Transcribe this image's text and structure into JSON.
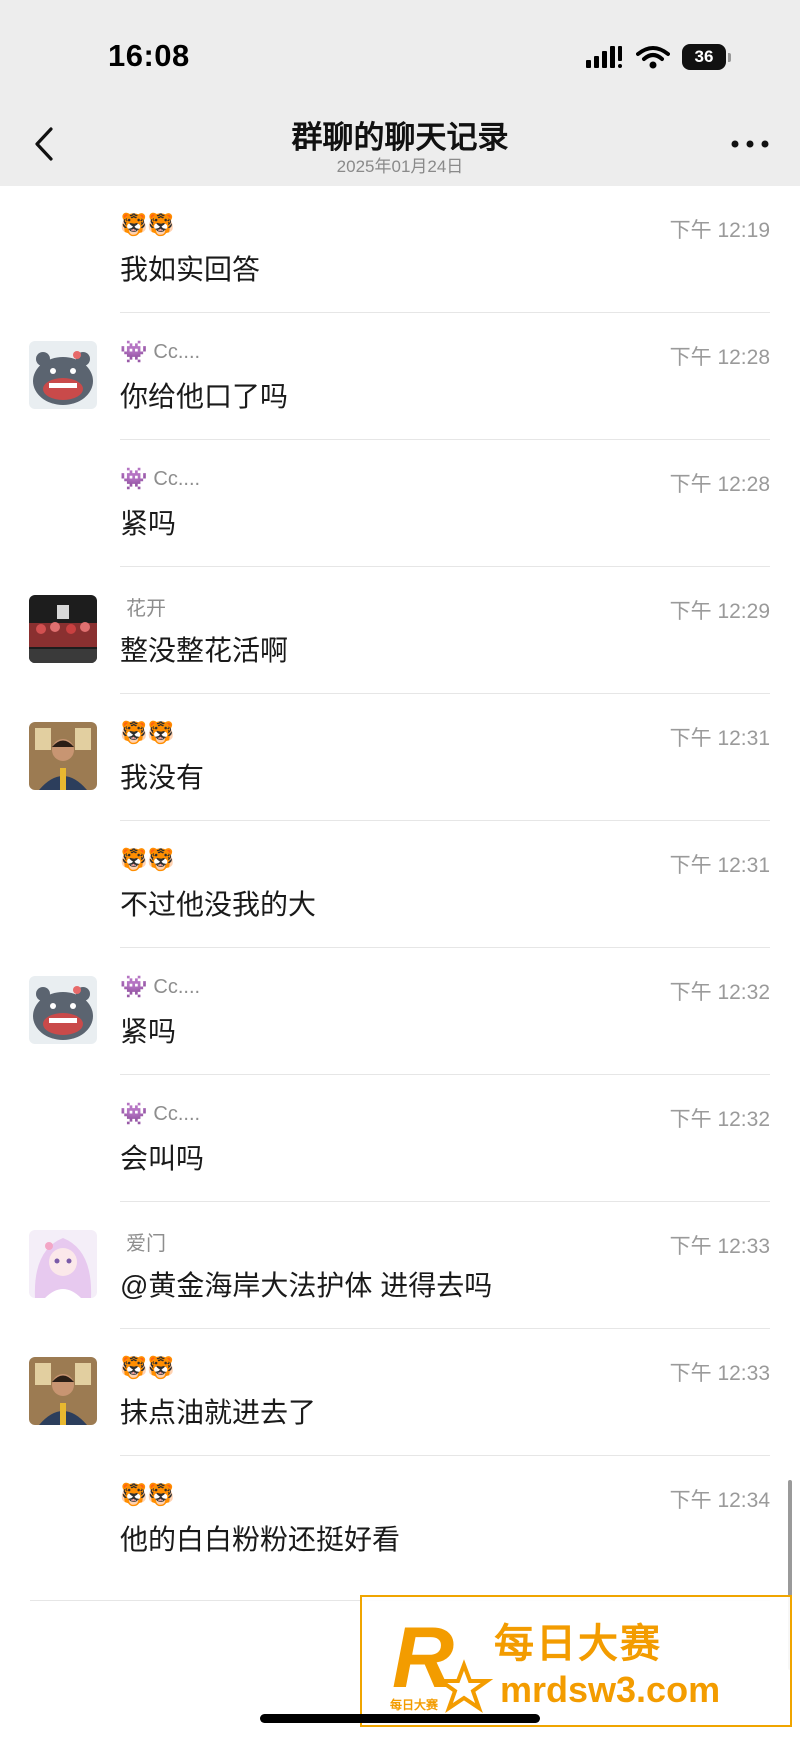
{
  "status_bar": {
    "time": "16:08",
    "battery": "36"
  },
  "nav": {
    "title": "群聊的聊天记录",
    "date": "2025年01月24日"
  },
  "messages": [
    {
      "sender": "",
      "sender_emoji": "🐯🐯",
      "avatar": "none",
      "time": "下午 12:19",
      "text": "我如实回答"
    },
    {
      "sender": "Cc....",
      "sender_emoji": "👾",
      "avatar": "hippo",
      "time": "下午 12:28",
      "text": "你给他口了吗"
    },
    {
      "sender": "Cc....",
      "sender_emoji": "👾",
      "avatar": "none",
      "time": "下午 12:28",
      "text": "紧吗"
    },
    {
      "sender": "花开",
      "sender_emoji": "",
      "avatar": "photo",
      "time": "下午 12:29",
      "text": "整没整花活啊"
    },
    {
      "sender": "",
      "sender_emoji": "🐯🐯",
      "avatar": "man",
      "time": "下午 12:31",
      "text": "我没有"
    },
    {
      "sender": "",
      "sender_emoji": "🐯🐯",
      "avatar": "none",
      "time": "下午 12:31",
      "text": "不过他没我的大"
    },
    {
      "sender": "Cc....",
      "sender_emoji": "👾",
      "avatar": "hippo",
      "time": "下午 12:32",
      "text": "紧吗"
    },
    {
      "sender": "Cc....",
      "sender_emoji": "👾",
      "avatar": "none",
      "time": "下午 12:32",
      "text": "会叫吗"
    },
    {
      "sender": "爱门",
      "sender_emoji": "",
      "avatar": "anime",
      "time": "下午 12:33",
      "text": "@黄金海岸大法护体 进得去吗"
    },
    {
      "sender": "",
      "sender_emoji": "🐯🐯",
      "avatar": "man",
      "time": "下午 12:33",
      "text": "抹点油就进去了"
    },
    {
      "sender": "",
      "sender_emoji": "🐯🐯",
      "avatar": "none",
      "time": "下午 12:34",
      "text": "他的白白粉粉还挺好看"
    }
  ],
  "watermark": {
    "title": "每日大赛",
    "url": "mrdsw3.com",
    "logo_letter": "R",
    "logo_small": "每日大赛"
  },
  "colors": {
    "header_bg": "#ededed",
    "watermark": "#f39c00"
  }
}
